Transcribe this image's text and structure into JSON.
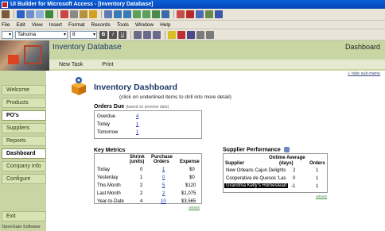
{
  "window": {
    "title": "UI Builder for Microsoft Access - [Inventory Database]"
  },
  "menubar": [
    "File",
    "Edit",
    "View",
    "Insert",
    "Format",
    "Records",
    "Tools",
    "Window",
    "Help"
  ],
  "format_toolbar": {
    "font": "Tahoma",
    "size": "8"
  },
  "header": {
    "title": "Inventory Database",
    "right_label": "Dashboard",
    "hide_link": "hide sub-menu"
  },
  "subnav": [
    "New Task",
    "Print"
  ],
  "sidebar": {
    "items": [
      "Welcome",
      "Products",
      "PO's",
      "Suppliers",
      "Reports",
      "Dashboard",
      "Company Info",
      "Configure"
    ],
    "exit": "Exit",
    "footer": "OpenGate Software"
  },
  "dashboard": {
    "title": "Inventory Dashboard",
    "subtitle": "(click on underlined items to drill into more detail)"
  },
  "orders_due": {
    "title": "Orders Due",
    "note": "(based on promise date)",
    "rows": [
      {
        "label": "Overdue",
        "value": "4"
      },
      {
        "label": "Today",
        "value": "1"
      },
      {
        "label": "Tomorrow",
        "value": "1"
      }
    ]
  },
  "key_metrics": {
    "title": "Key Metrics",
    "headers": {
      "shrink_top": "Shrink",
      "shrink_bottom": "(units)",
      "po_top": "Purchase",
      "po_bottom": "Orders",
      "expense": "Expense"
    },
    "rows": [
      {
        "label": "Today",
        "shrink": "0",
        "orders": "1",
        "expense": "$0"
      },
      {
        "label": "Yesterday",
        "shrink": "1",
        "orders": "0",
        "expense": "$0"
      },
      {
        "label": "This Month",
        "shrink": "2",
        "orders": "5",
        "expense": "$120"
      },
      {
        "label": "Last Month",
        "shrink": "2",
        "orders": "2",
        "expense": "$1,075"
      },
      {
        "label": "Year-to-Date",
        "shrink": "4",
        "orders": "10",
        "expense": "$3,565"
      }
    ],
    "refresh": "refresh"
  },
  "supplier_performance": {
    "title": "Supplier Performance",
    "headers": {
      "supplier": "Supplier",
      "ontime_top": "Ontime Average",
      "ontime_bottom": "(days)",
      "orders": "Orders"
    },
    "rows": [
      {
        "supplier": "New Orleans Cajun Delights",
        "ontime": "2",
        "orders": "1"
      },
      {
        "supplier": "Cooperativa de Quesos 'Las",
        "ontime": "0",
        "orders": "1"
      },
      {
        "supplier": "Grandma Kelly's Homestead",
        "ontime": "-1",
        "orders": "1"
      }
    ],
    "refresh": "refresh"
  }
}
